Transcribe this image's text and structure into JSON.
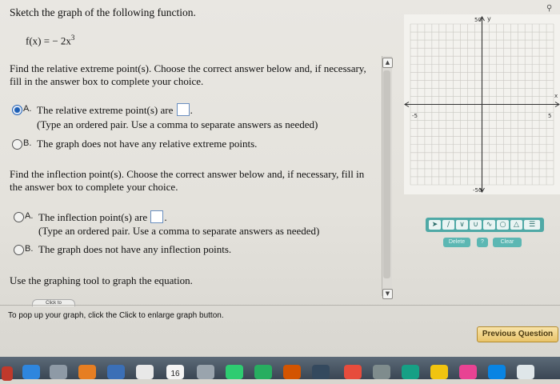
{
  "question": {
    "title": "Sketch the graph of the following function.",
    "function_lhs": "f(x) = − 2x",
    "function_exponent": "3"
  },
  "part_extreme": {
    "prompt_line1": "Find the relative extreme point(s). Choose the correct answer below and, if necessary,",
    "prompt_line2": "fill in the answer box to complete your choice.",
    "option_a_letter": "A.",
    "option_a_text": "The relative extreme point(s) are",
    "option_a_suffix": ".",
    "option_a_hint": "(Type an ordered pair. Use a comma to separate answers as needed)",
    "option_b_letter": "B.",
    "option_b_text": "The graph does not have any relative extreme points.",
    "selected": "A"
  },
  "part_inflection": {
    "prompt_line1": "Find the inflection point(s). Choose the correct answer below and, if necessary, fill in",
    "prompt_line2": "the answer box to complete your choice.",
    "option_a_letter": "A.",
    "option_a_text": "The inflection point(s) are",
    "option_a_suffix": ".",
    "option_a_hint": "(Type an ordered pair. Use a comma to separate answers as needed)",
    "option_b_letter": "B.",
    "option_b_text": "The graph does not have any inflection points."
  },
  "graphing": {
    "instruction": "Use the graphing tool to graph the equation.",
    "click_button": "Click to",
    "popup_note": "To pop up your graph, click the Click to enlarge graph button."
  },
  "graph": {
    "y_axis_label": "y",
    "x_axis_label": "x",
    "y_max_label": "50",
    "y_min_label": "-50",
    "x_min_label": "-5",
    "x_max_label": "5",
    "x_range": [
      -5,
      5
    ],
    "y_range": [
      -50,
      50
    ]
  },
  "toolbar": {
    "delete_label": "Delete",
    "info_label": "?",
    "clear_label": "Clear",
    "accent_color": "#4fa9a6"
  },
  "navigation": {
    "previous_label": "Previous Question"
  },
  "dock": {
    "calendar_day": "16"
  }
}
